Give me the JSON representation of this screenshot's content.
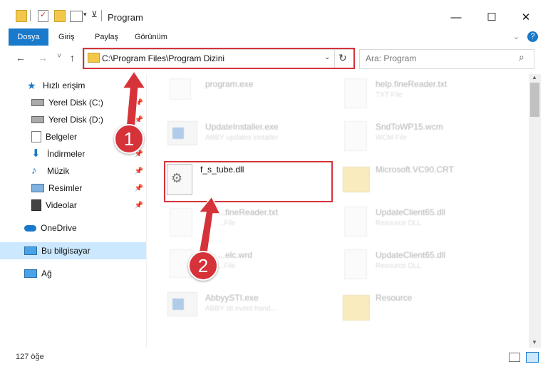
{
  "window": {
    "title": "Program",
    "minimize_glyph": "—",
    "maximize_glyph": "☐",
    "close_glyph": "✕"
  },
  "ribbon": {
    "tabs": [
      "Dosya",
      "Giriş",
      "Paylaş",
      "Görünüm"
    ],
    "accent": "#1979ca",
    "help_glyph": "?"
  },
  "nav": {
    "back_glyph": "←",
    "forward_glyph": "→",
    "recent_glyph": "˅",
    "up_glyph": "↑",
    "address": "C:\\Program Files\\Program Dizini",
    "refresh_glyph": "↻",
    "search_placeholder": "Ara: Program",
    "search_glyph": "⌕"
  },
  "sidebar": {
    "items": [
      {
        "label": "Hızlı erişim",
        "icon": "star-icon",
        "pinned": false
      },
      {
        "label": "Yerel Disk (C:)",
        "icon": "disk-icon",
        "pinned": true
      },
      {
        "label": "Yerel Disk (D:)",
        "icon": "disk-icon",
        "pinned": true
      },
      {
        "label": "Belgeler",
        "icon": "document-icon",
        "pinned": true
      },
      {
        "label": "İndirmeler",
        "icon": "download-icon",
        "pinned": true
      },
      {
        "label": "Müzik",
        "icon": "music-icon",
        "pinned": true
      },
      {
        "label": "Resimler",
        "icon": "picture-icon",
        "pinned": true
      },
      {
        "label": "Videolar",
        "icon": "video-icon",
        "pinned": true
      },
      {
        "label": "OneDrive",
        "icon": "cloud-icon",
        "pinned": false
      },
      {
        "label": "Bu bilgisayar",
        "icon": "computer-icon",
        "pinned": false
      },
      {
        "label": "Ağ",
        "icon": "network-icon",
        "pinned": false
      }
    ]
  },
  "files": {
    "highlighted": {
      "name": "f_s_tube.dll"
    },
    "left_column": [
      {
        "name": "program.exe",
        "sub": ""
      },
      {
        "name": "UpdateInstaller.exe",
        "sub": "ABBY updates installer"
      },
      {
        "name": "",
        "sub": ""
      },
      {
        "name": "...fineReader.txt",
        "sub": "...File"
      },
      {
        "name": "...elc.wrd",
        "sub": "...File"
      },
      {
        "name": "AbbyySTI.exe",
        "sub": "ABBY sti event hand..."
      }
    ],
    "right_column": [
      {
        "name": "help.fineReader.txt",
        "sub": "TXT File"
      },
      {
        "name": "SndToWP15.wcm",
        "sub": "WCM File"
      },
      {
        "name": "Microsoft.VC90.CRT",
        "sub": ""
      },
      {
        "name": "UpdateClient65.dll",
        "sub": "Resource DLL"
      },
      {
        "name": "UpdateClient65.dll",
        "sub": "Resource DLL"
      },
      {
        "name": "Resource",
        "sub": ""
      }
    ]
  },
  "annotations": {
    "step1": "1",
    "step2": "2",
    "color": "#d6323a"
  },
  "status": {
    "item_count": "127 öğe"
  }
}
